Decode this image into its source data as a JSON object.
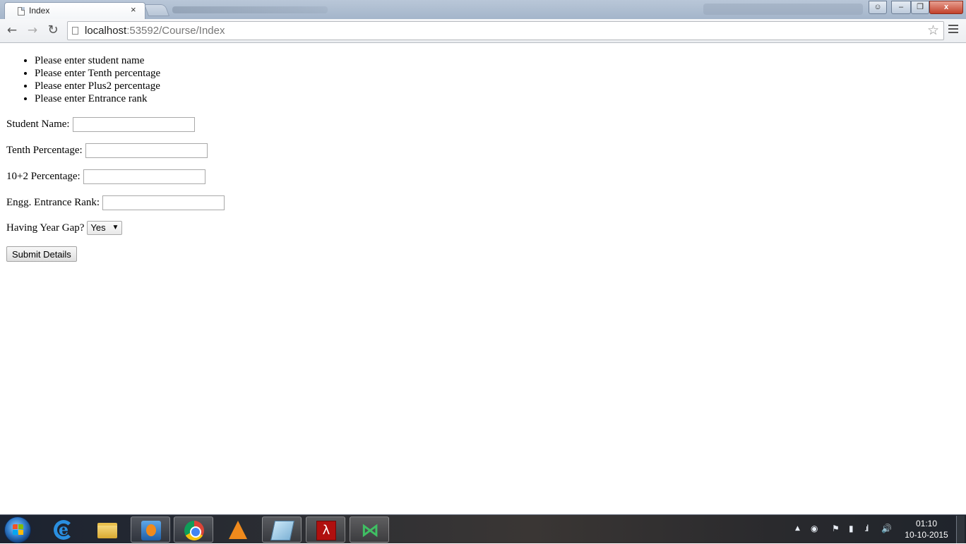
{
  "browser": {
    "tab": {
      "title": "Index",
      "close_glyph": "×"
    },
    "window_controls": {
      "minimize": "–",
      "restore": "❐",
      "close": "x"
    },
    "toolbar": {
      "back_icon": "←",
      "forward_icon": "→",
      "reload_icon": "↻",
      "url_host": "localhost",
      "url_rest": ":53592/Course/Index",
      "bookmark_icon": "☆"
    }
  },
  "page": {
    "validation_errors": [
      "Please enter student name",
      "Please enter Tenth percentage",
      "Please enter Plus2 percentage",
      "Please enter Entrance rank"
    ],
    "fields": {
      "student_name": {
        "label": "Student Name:",
        "value": ""
      },
      "tenth_percentage": {
        "label": "Tenth Percentage:",
        "value": ""
      },
      "plus2_percentage": {
        "label": "10+2 Percentage:",
        "value": ""
      },
      "entrance_rank": {
        "label": "Engg. Entrance Rank:",
        "value": ""
      },
      "year_gap": {
        "label": "Having Year Gap?",
        "selected": "Yes",
        "arrow": "▼"
      }
    },
    "submit_label": "Submit Details"
  },
  "taskbar": {
    "apps": [
      "start",
      "internet-explorer",
      "file-explorer",
      "windows-media-player",
      "chrome",
      "vlc",
      "notepad",
      "adobe-acrobat",
      "visual-studio"
    ],
    "tray": {
      "show_hidden": "▲",
      "flag": "⚑",
      "volume": "🔊"
    },
    "clock": {
      "time": "01:10",
      "date": "10-10-2015"
    }
  },
  "colors": {
    "titlebar": "#a4b5ca",
    "close_button": "#c2412b",
    "taskbar": "#2c2e33"
  }
}
